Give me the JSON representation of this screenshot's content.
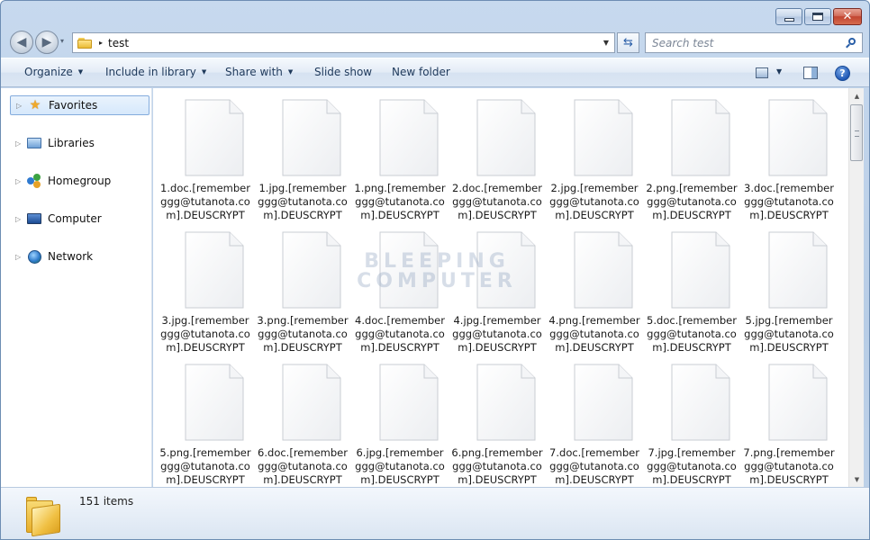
{
  "window": {
    "caption": {
      "minimize": "",
      "maximize": "",
      "close": "✕"
    }
  },
  "nav": {
    "back_icon": "back-arrow-icon",
    "forward_icon": "forward-arrow-icon",
    "history_dropdown": "▾",
    "breadcrumb": [
      "test"
    ],
    "breadcrumb_separator": "▸",
    "address_dropdown": "▼",
    "refresh_icon": "⇆",
    "search_placeholder": "Search test"
  },
  "toolbar": {
    "organize": "Organize",
    "include_in_library": "Include in library",
    "share_with": "Share with",
    "slide_show": "Slide show",
    "new_folder": "New folder",
    "dropdown_arrow": "▼",
    "help": "?"
  },
  "sidebar": {
    "items": [
      {
        "label": "Favorites",
        "icon": "star-icon",
        "selected": true
      },
      {
        "label": "Libraries",
        "icon": "library-icon",
        "selected": false
      },
      {
        "label": "Homegroup",
        "icon": "homegroup-icon",
        "selected": false
      },
      {
        "label": "Computer",
        "icon": "computer-icon",
        "selected": false
      },
      {
        "label": "Network",
        "icon": "network-icon",
        "selected": false
      }
    ],
    "expander": "▷"
  },
  "files": [
    {
      "name": "1.doc.[remembergggg@tutanota.com].DEUSCRYPT",
      "lines": [
        "1.doc.[remember",
        "ggg@tutanota.co",
        "m].DEUSCRYPT"
      ]
    },
    {
      "name": "1.jpg.[remembergggg@tutanota.com].DEUSCRYPT",
      "lines": [
        "1.jpg.[remember",
        "ggg@tutanota.co",
        "m].DEUSCRYPT"
      ]
    },
    {
      "name": "1.png.[remembergggg@tutanota.com].DEUSCRYPT",
      "lines": [
        "1.png.[remember",
        "ggg@tutanota.co",
        "m].DEUSCRYPT"
      ]
    },
    {
      "name": "2.doc.[remembergggg@tutanota.com].DEUSCRYPT",
      "lines": [
        "2.doc.[remember",
        "ggg@tutanota.co",
        "m].DEUSCRYPT"
      ]
    },
    {
      "name": "2.jpg.[remembergggg@tutanota.com].DEUSCRYPT",
      "lines": [
        "2.jpg.[remember",
        "ggg@tutanota.co",
        "m].DEUSCRYPT"
      ]
    },
    {
      "name": "2.png.[remembergggg@tutanota.com].DEUSCRYPT",
      "lines": [
        "2.png.[remember",
        "ggg@tutanota.co",
        "m].DEUSCRYPT"
      ]
    },
    {
      "name": "3.doc.[remembergggg@tutanota.com].DEUSCRYPT",
      "lines": [
        "3.doc.[remember",
        "ggg@tutanota.co",
        "m].DEUSCRYPT"
      ]
    },
    {
      "name": "3.jpg.[remembergggg@tutanota.com].DEUSCRYPT",
      "lines": [
        "3.jpg.[remember",
        "ggg@tutanota.co",
        "m].DEUSCRYPT"
      ]
    },
    {
      "name": "3.png.[remembergggg@tutanota.com].DEUSCRYPT",
      "lines": [
        "3.png.[remember",
        "ggg@tutanota.co",
        "m].DEUSCRYPT"
      ]
    },
    {
      "name": "4.doc.[remembergggg@tutanota.com].DEUSCRYPT",
      "lines": [
        "4.doc.[remember",
        "ggg@tutanota.co",
        "m].DEUSCRYPT"
      ]
    },
    {
      "name": "4.jpg.[remembergggg@tutanota.com].DEUSCRYPT",
      "lines": [
        "4.jpg.[remember",
        "ggg@tutanota.co",
        "m].DEUSCRYPT"
      ]
    },
    {
      "name": "4.png.[remembergggg@tutanota.com].DEUSCRYPT",
      "lines": [
        "4.png.[remember",
        "ggg@tutanota.co",
        "m].DEUSCRYPT"
      ]
    },
    {
      "name": "5.doc.[remembergggg@tutanota.com].DEUSCRYPT",
      "lines": [
        "5.doc.[remember",
        "ggg@tutanota.co",
        "m].DEUSCRYPT"
      ]
    },
    {
      "name": "5.jpg.[remembergggg@tutanota.com].DEUSCRYPT",
      "lines": [
        "5.jpg.[remember",
        "ggg@tutanota.co",
        "m].DEUSCRYPT"
      ]
    },
    {
      "name": "5.png.[remembergggg@tutanota.com].DEUSCRYPT",
      "lines": [
        "5.png.[remember",
        "ggg@tutanota.co",
        "m].DEUSCRYPT"
      ]
    },
    {
      "name": "6.doc.[remembergggg@tutanota.com].DEUSCRYPT",
      "lines": [
        "6.doc.[remember",
        "ggg@tutanota.co",
        "m].DEUSCRYPT"
      ]
    },
    {
      "name": "6.jpg.[remembergggg@tutanota.com].DEUSCRYPT",
      "lines": [
        "6.jpg.[remember",
        "ggg@tutanota.co",
        "m].DEUSCRYPT"
      ]
    },
    {
      "name": "6.png.[remembergggg@tutanota.com].DEUSCRYPT",
      "lines": [
        "6.png.[remember",
        "ggg@tutanota.co",
        "m].DEUSCRYPT"
      ]
    },
    {
      "name": "7.doc.[remembergggg@tutanota.com].DEUSCRYPT",
      "lines": [
        "7.doc.[remember",
        "ggg@tutanota.co",
        "m].DEUSCRYPT"
      ]
    },
    {
      "name": "7.jpg.[remembergggg@tutanota.com].DEUSCRYPT",
      "lines": [
        "7.jpg.[remember",
        "ggg@tutanota.co",
        "m].DEUSCRYPT"
      ]
    },
    {
      "name": "7.png.[remembergggg@tutanota.com].DEUSCRYPT",
      "lines": [
        "7.png.[remember",
        "ggg@tutanota.co",
        "m].DEUSCRYPT"
      ]
    }
  ],
  "watermark": {
    "line1": "BLEEPING",
    "line2": "COMPUTER"
  },
  "details": {
    "item_count": "151 items"
  },
  "colors": {
    "toolbar_text": "#1e395b",
    "accent_blue": "#2a5fa8",
    "selection_border": "#84acdd"
  }
}
